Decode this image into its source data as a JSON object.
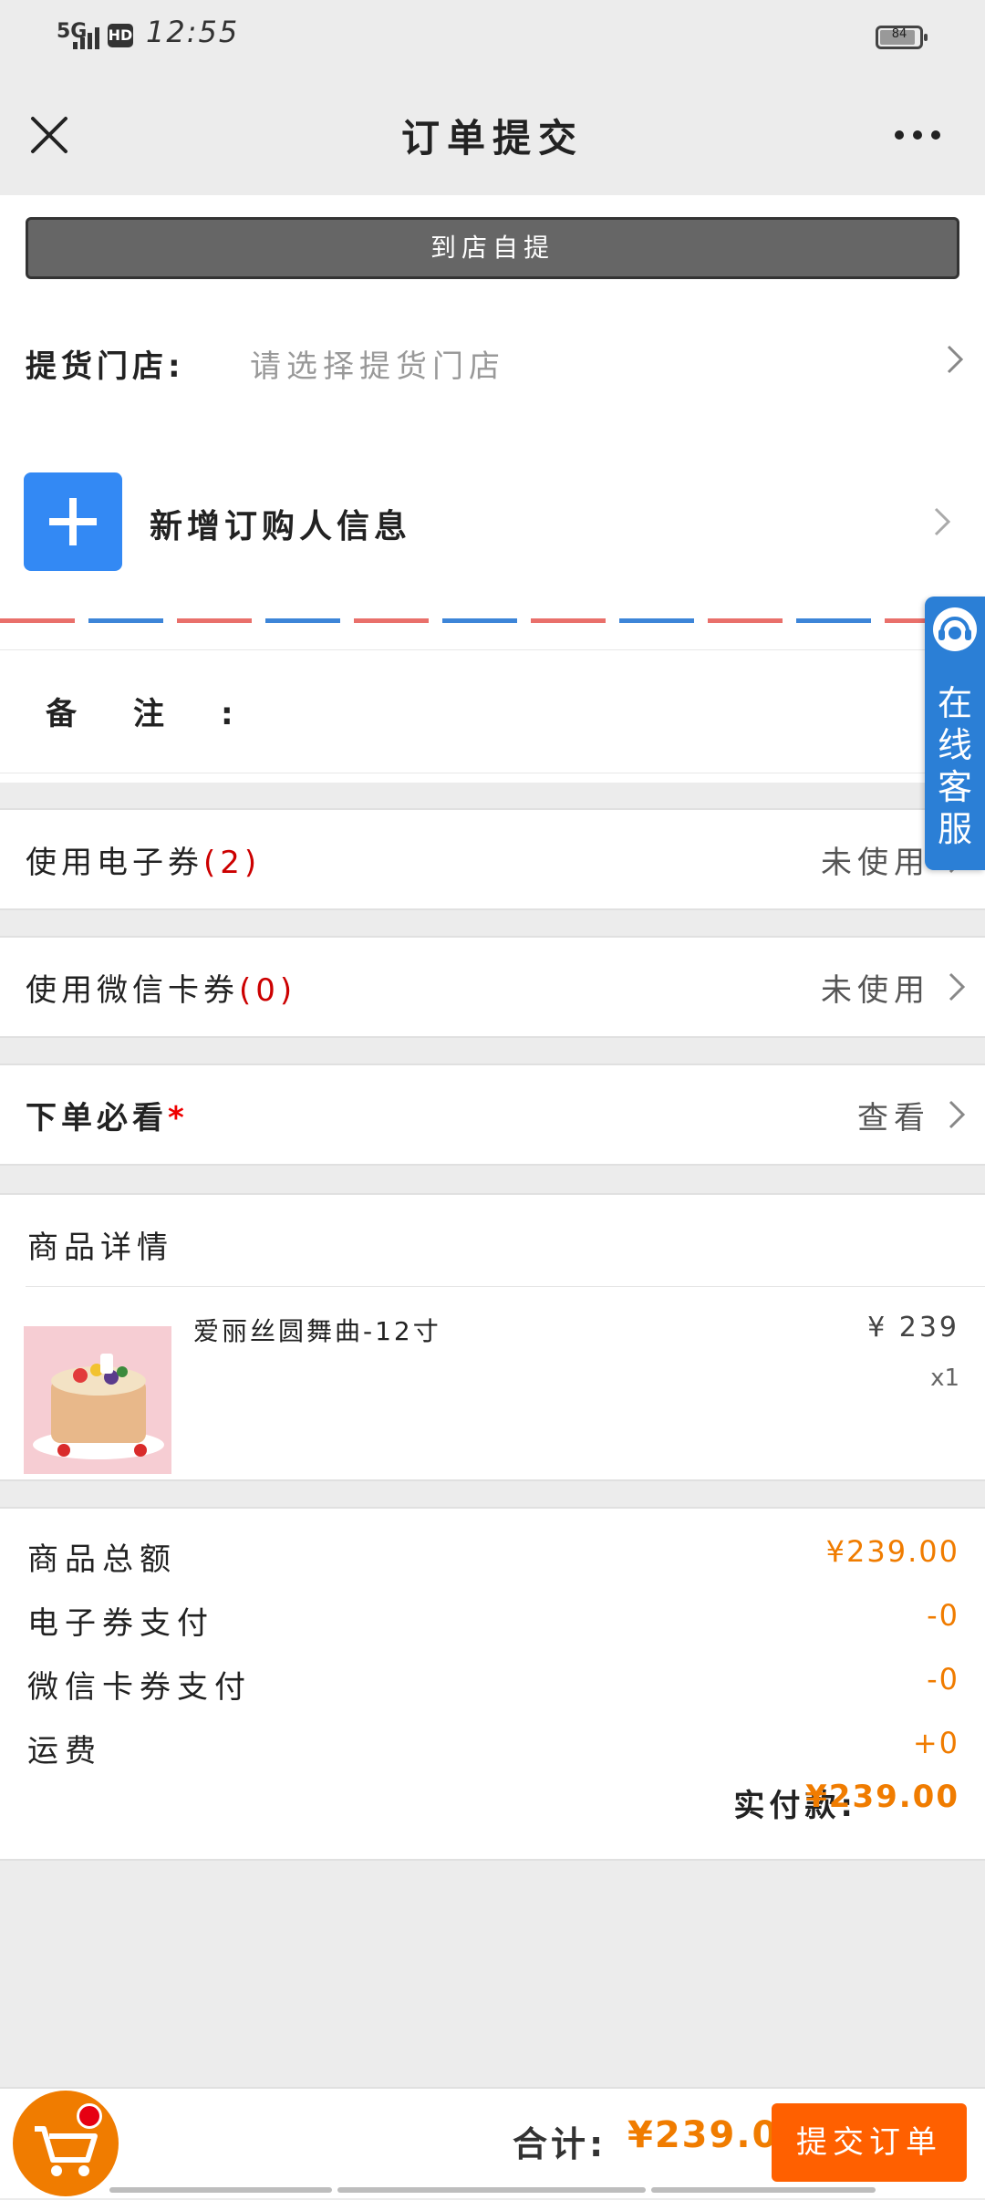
{
  "status_bar": {
    "network": "5G",
    "hd": "HD",
    "time": "12:55",
    "battery": "84"
  },
  "nav": {
    "title": "订单提交",
    "close_icon": "close-icon",
    "more_icon": "more-icon"
  },
  "pickup": {
    "mode_label": "到店自提"
  },
  "store": {
    "label": "提货门店:",
    "placeholder": "请选择提货门店"
  },
  "buyer": {
    "add_label": "新增订购人信息",
    "icon": "plus-icon"
  },
  "remark": {
    "label": "备注:"
  },
  "coupons": {
    "e_coupon": {
      "label": "使用电子券",
      "count": "(2)",
      "status": "未使用"
    },
    "wechat_card": {
      "label": "使用微信卡券",
      "count": "(0)",
      "status": "未使用"
    }
  },
  "notice": {
    "label": "下单必看",
    "required_mark": "*",
    "action": "查看"
  },
  "goods": {
    "title": "商品详情",
    "items": [
      {
        "name": "爱丽丝圆舞曲-12寸",
        "price": "¥ 239",
        "qty": "x1"
      }
    ]
  },
  "summary": {
    "rows": [
      {
        "label": "商品总额",
        "value": "¥239.00"
      },
      {
        "label": "电子券支付",
        "value": "-0"
      },
      {
        "label": "微信卡券支付",
        "value": "-0"
      },
      {
        "label": "运费",
        "value": "+0"
      }
    ],
    "total_label": "实付款:",
    "total_value": "¥239.00"
  },
  "customer_service": {
    "label": "在线客服"
  },
  "footer": {
    "total_label": "合计:",
    "total_value": "¥239.00",
    "submit_label": "提交订单"
  },
  "colors": {
    "accent": "#f07c00",
    "submit": "#ff6000",
    "primary_blue": "#3389f4"
  }
}
